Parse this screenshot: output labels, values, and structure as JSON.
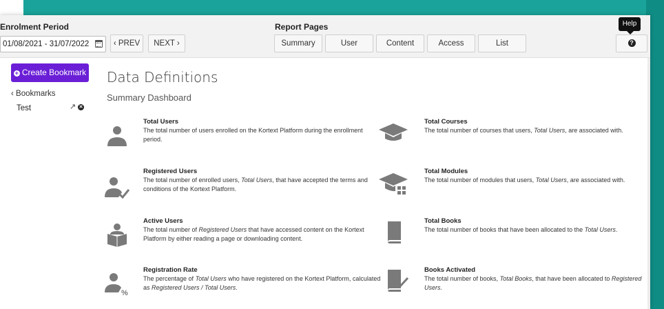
{
  "toolbar": {
    "enrolment_label": "Enrolment Period",
    "date_range": "01/08/2021 - 31/07/2022",
    "prev": "‹ PREV",
    "next": "NEXT ›",
    "report_label": "Report Pages",
    "tabs": [
      "Summary",
      "User",
      "Content",
      "Access",
      "List"
    ],
    "help_tooltip": "Help",
    "help_icon": "?"
  },
  "sidebar": {
    "create_bookmark": "Create Bookmark",
    "bookmarks_link": "‹ Bookmarks",
    "bookmark_item": "Test"
  },
  "main": {
    "title": "Data Definitions",
    "subtitle": "Summary Dashboard",
    "definitions": [
      {
        "title": "Total Users",
        "desc": [
          "The total number of users enrolled on the Kortext Platform during the enrollment period."
        ],
        "icon": "user-icon"
      },
      {
        "title": "Total Courses",
        "desc": [
          "The total number of courses that users, ",
          {
            "i": "Total Users"
          },
          ", are associated with."
        ],
        "icon": "graduation-cap-icon"
      },
      {
        "title": "Registered Users",
        "desc": [
          "The total number of enrolled users, ",
          {
            "i": "Total Users"
          },
          ", that have accepted the terms and conditions of the Kortext Platform."
        ],
        "icon": "user-check-icon"
      },
      {
        "title": "Total Modules",
        "desc": [
          "The total number of modules that users, ",
          {
            "i": "Total Users"
          },
          ", are associated with."
        ],
        "icon": "modules-icon"
      },
      {
        "title": "Active Users",
        "desc": [
          "The total number of ",
          {
            "i": "Registered Users"
          },
          " that have accessed content on the Kortext Platform by either reading a page or downloading content."
        ],
        "icon": "user-reading-icon"
      },
      {
        "title": "Total Books",
        "desc": [
          "The total number of books that have been allocated to the ",
          {
            "i": "Total Users"
          },
          "."
        ],
        "icon": "book-icon"
      },
      {
        "title": "Registration Rate",
        "desc": [
          "The percentage of ",
          {
            "i": "Total Users"
          },
          " who have registered on the Kortext Platform, calculated as ",
          {
            "i": "Registered Users / Total Users"
          },
          "."
        ],
        "icon": "user-percent-icon"
      },
      {
        "title": "Books Activated",
        "desc": [
          "The total number of books, ",
          {
            "i": "Total Books"
          },
          ", that have been allocated to ",
          {
            "i": "Registered Users"
          },
          "."
        ],
        "icon": "book-check-icon"
      }
    ]
  },
  "colors": {
    "accent": "#6a1fd6",
    "teal": "#1aa39a",
    "icon_gray": "#7a7a7a"
  }
}
